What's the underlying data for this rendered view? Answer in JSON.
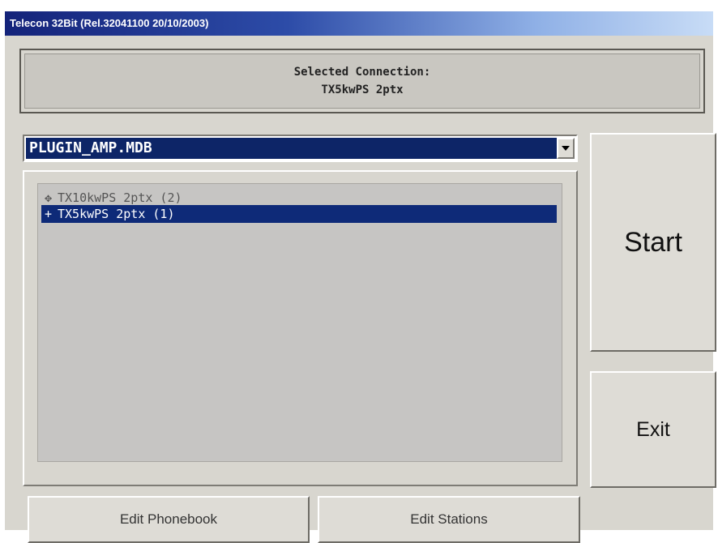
{
  "window": {
    "title": "Telecon 32Bit (Rel.32041100 20/10/2003)"
  },
  "connection": {
    "heading": "Selected Connection:",
    "value": "TX5kwPS 2ptx"
  },
  "database_combo": {
    "selected": "PLUGIN_AMP.MDB",
    "dropdown_icon": "chevron-down-icon"
  },
  "connection_list": {
    "items": [
      {
        "icon": "plus-node-icon",
        "glyph": "✥",
        "label": "TX10kwPS 2ptx (2)",
        "selected": false
      },
      {
        "icon": "bullet-icon",
        "glyph": "+",
        "label": "TX5kwPS 2ptx (1)",
        "selected": true
      }
    ]
  },
  "buttons": {
    "start": "Start",
    "exit": "Exit",
    "edit_phonebook": "Edit Phonebook",
    "edit_stations": "Edit Stations"
  },
  "colors": {
    "selection": "#0e2a78",
    "face": "#d8d6cf",
    "title_start": "#14237a"
  }
}
